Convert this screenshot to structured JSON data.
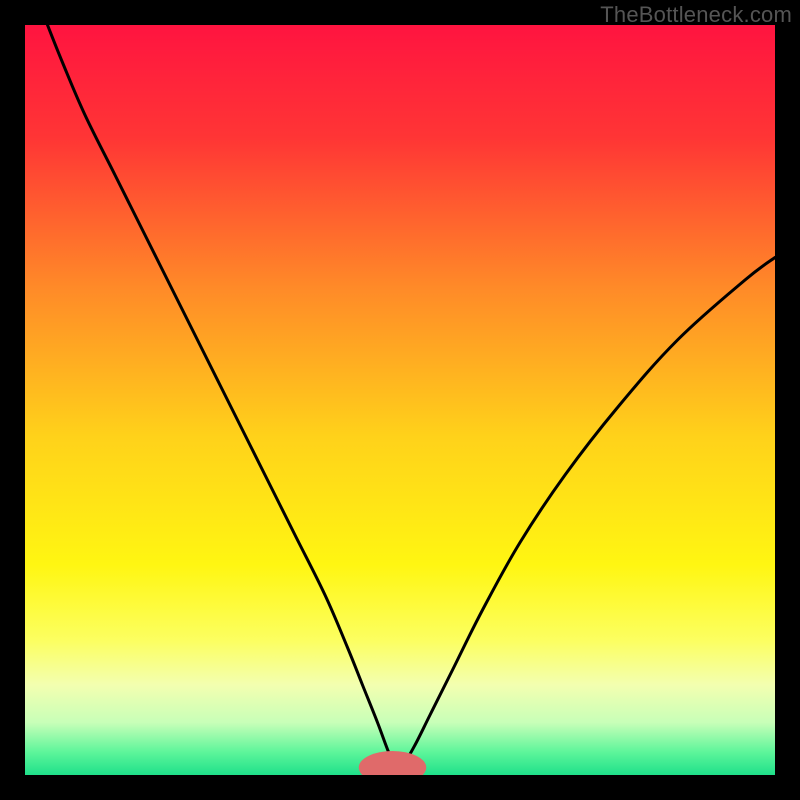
{
  "watermark": "TheBottleneck.com",
  "chart_data": {
    "type": "line",
    "title": "",
    "xlabel": "",
    "ylabel": "",
    "xlim": [
      0,
      100
    ],
    "ylim": [
      0,
      100
    ],
    "grid": false,
    "legend": false,
    "background": {
      "type": "vertical-gradient",
      "stops": [
        {
          "offset": 0.0,
          "color": "#ff1440"
        },
        {
          "offset": 0.15,
          "color": "#ff3535"
        },
        {
          "offset": 0.35,
          "color": "#ff8a28"
        },
        {
          "offset": 0.55,
          "color": "#ffd21a"
        },
        {
          "offset": 0.72,
          "color": "#fff612"
        },
        {
          "offset": 0.82,
          "color": "#fcff60"
        },
        {
          "offset": 0.88,
          "color": "#f3ffb0"
        },
        {
          "offset": 0.93,
          "color": "#c8ffb8"
        },
        {
          "offset": 0.97,
          "color": "#5cf59a"
        },
        {
          "offset": 1.0,
          "color": "#1fe08a"
        }
      ]
    },
    "curve_color": "#000000",
    "curve_width": 3,
    "marker": {
      "x": 49,
      "y": 1,
      "color": "#e06a6a",
      "rx": 4.5,
      "ry": 2.2
    },
    "series": [
      {
        "name": "bottleneck-curve",
        "x": [
          3,
          5,
          8,
          12,
          16,
          20,
          24,
          28,
          32,
          36,
          40,
          43,
          45,
          47,
          48.5,
          49.5,
          50.5,
          52,
          54,
          57,
          61,
          66,
          72,
          79,
          87,
          96,
          100
        ],
        "y": [
          100,
          95,
          88,
          80,
          72,
          64,
          56,
          48,
          40,
          32,
          24,
          17,
          12,
          7,
          3,
          1,
          1.5,
          4,
          8,
          14,
          22,
          31,
          40,
          49,
          58,
          66,
          69
        ]
      }
    ]
  }
}
